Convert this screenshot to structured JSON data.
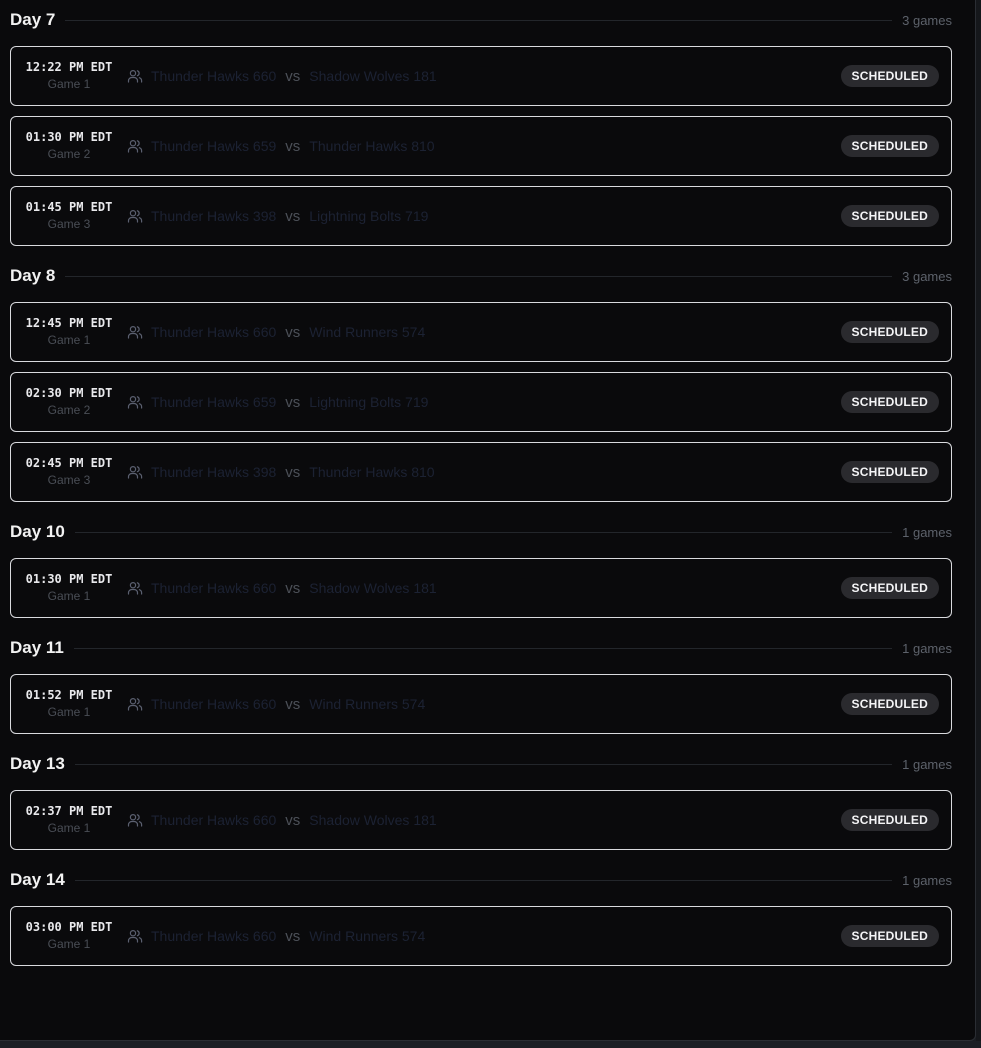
{
  "days": [
    {
      "title": "Day 7",
      "count": "3 games",
      "games": [
        {
          "time": "12:22 PM EDT",
          "number": "Game 1",
          "home": "Thunder Hawks 660",
          "vs": "vs",
          "away": "Shadow Wolves 181",
          "status": "SCHEDULED"
        },
        {
          "time": "01:30 PM EDT",
          "number": "Game 2",
          "home": "Thunder Hawks 659",
          "vs": "vs",
          "away": "Thunder Hawks 810",
          "status": "SCHEDULED"
        },
        {
          "time": "01:45 PM EDT",
          "number": "Game 3",
          "home": "Thunder Hawks 398",
          "vs": "vs",
          "away": "Lightning Bolts 719",
          "status": "SCHEDULED"
        }
      ]
    },
    {
      "title": "Day 8",
      "count": "3 games",
      "games": [
        {
          "time": "12:45 PM EDT",
          "number": "Game 1",
          "home": "Thunder Hawks 660",
          "vs": "vs",
          "away": "Wind Runners 574",
          "status": "SCHEDULED"
        },
        {
          "time": "02:30 PM EDT",
          "number": "Game 2",
          "home": "Thunder Hawks 659",
          "vs": "vs",
          "away": "Lightning Bolts 719",
          "status": "SCHEDULED"
        },
        {
          "time": "02:45 PM EDT",
          "number": "Game 3",
          "home": "Thunder Hawks 398",
          "vs": "vs",
          "away": "Thunder Hawks 810",
          "status": "SCHEDULED"
        }
      ]
    },
    {
      "title": "Day 10",
      "count": "1 games",
      "games": [
        {
          "time": "01:30 PM EDT",
          "number": "Game 1",
          "home": "Thunder Hawks 660",
          "vs": "vs",
          "away": "Shadow Wolves 181",
          "status": "SCHEDULED"
        }
      ]
    },
    {
      "title": "Day 11",
      "count": "1 games",
      "games": [
        {
          "time": "01:52 PM EDT",
          "number": "Game 1",
          "home": "Thunder Hawks 660",
          "vs": "vs",
          "away": "Wind Runners 574",
          "status": "SCHEDULED"
        }
      ]
    },
    {
      "title": "Day 13",
      "count": "1 games",
      "games": [
        {
          "time": "02:37 PM EDT",
          "number": "Game 1",
          "home": "Thunder Hawks 660",
          "vs": "vs",
          "away": "Shadow Wolves 181",
          "status": "SCHEDULED"
        }
      ]
    },
    {
      "title": "Day 14",
      "count": "1 games",
      "games": [
        {
          "time": "03:00 PM EDT",
          "number": "Game 1",
          "home": "Thunder Hawks 660",
          "vs": "vs",
          "away": "Wind Runners 574",
          "status": "SCHEDULED"
        }
      ]
    }
  ],
  "icons": {
    "team": "users-icon"
  },
  "colors": {
    "background": "#0a0a0c",
    "card_border": "#d9dade",
    "badge_bg": "#2a2a2e",
    "badge_text": "#f4f4f6",
    "team_text": "#1c2233"
  }
}
